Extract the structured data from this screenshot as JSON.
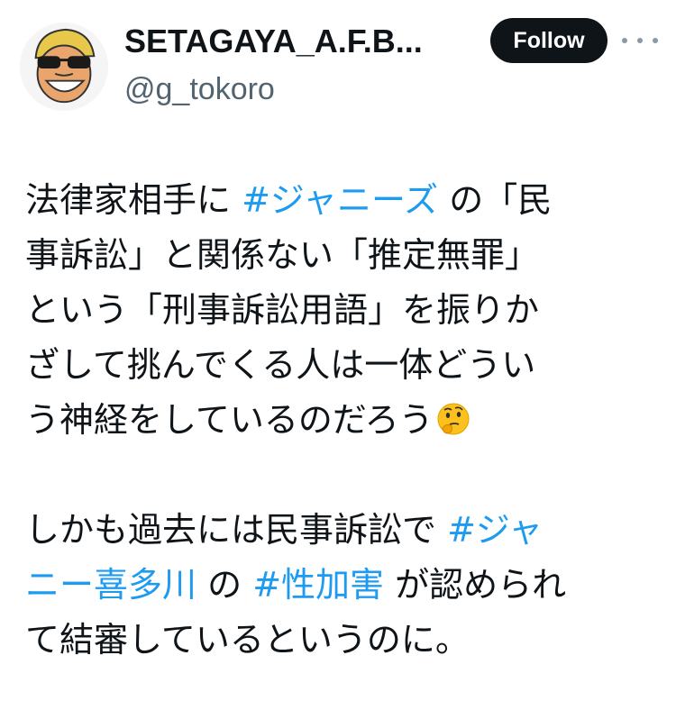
{
  "header": {
    "display_name": "SETAGAYA_A.F.B...",
    "handle": "@g_tokoro",
    "follow_label": "Follow",
    "avatar_icon": "cartoon-face-sunglasses-icon",
    "more_icon": "more-options-icon"
  },
  "tweet": {
    "l1a": "法律家相手に ",
    "l1tag": "#ジャニーズ",
    "l1b": " の「民",
    "l2": "事訴訟」と関係ない「推定無罪」",
    "l3": "という「刑事訴訟用語」を振りか",
    "l4": "ざして挑んでくる人は一体どうい",
    "l5": "う神経をしているのだろう",
    "emoji_icon": "thinking-face-emoji-icon",
    "l6a": "しかも過去には民事訴訟で ",
    "l6tag": "#ジャ",
    "l7tag": "ニー喜多川",
    "l7b": " の ",
    "l7tag2": "#性加害",
    "l7c": " が認められ",
    "l8": "て結審しているというのに。"
  },
  "colors": {
    "text": "#0f1419",
    "secondary": "#536471",
    "hashtag": "#1d9bf0",
    "button_bg": "#0f1419",
    "button_text": "#ffffff"
  }
}
